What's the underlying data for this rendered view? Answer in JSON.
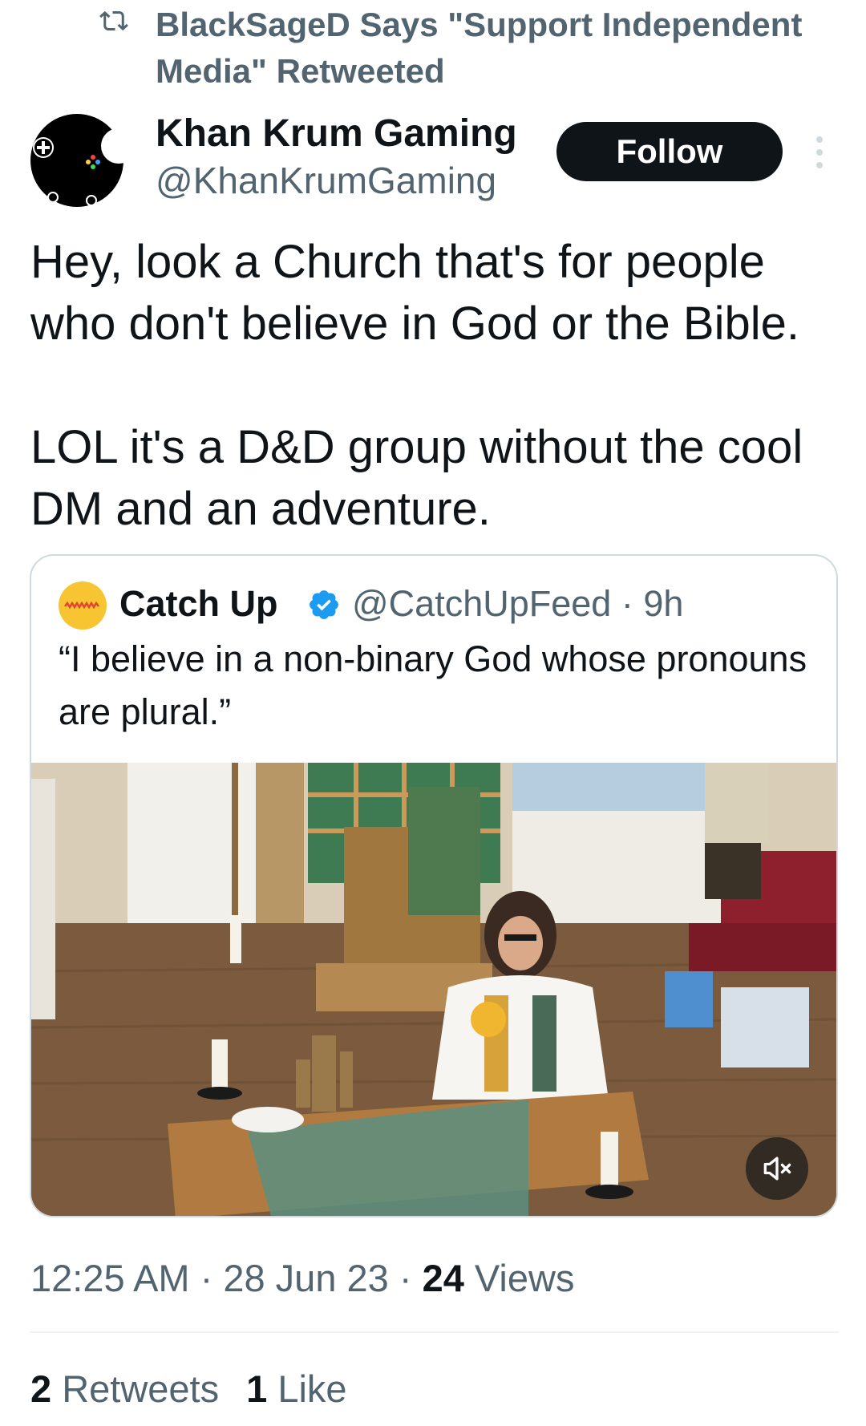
{
  "retweet_banner": {
    "text": "BlackSageD Says \"Support Independent Media\" Retweeted",
    "icon": "retweet-icon"
  },
  "author": {
    "name": "Khan Krum Gaming",
    "handle": "@KhanKrumGaming",
    "avatar_icon": "gamepad-avatar"
  },
  "follow_button": {
    "label": "Follow"
  },
  "more_menu": {
    "icon": "more-vertical-icon"
  },
  "tweet": {
    "text_line1": "Hey, look a Church that's for people who don't believe in God or the Bible.",
    "text_line2": "LOL it's a D&D group without the cool DM and an adventure."
  },
  "quote": {
    "name": "Catch Up",
    "handle_time": "@CatchUpFeed · 9h",
    "text": "“I believe in a non-binary God whose pronouns are plural.”",
    "media_icon": "video-thumbnail",
    "mute_icon": "mute-icon"
  },
  "meta": {
    "time_date": "12:25 AM · 28 Jun 23 · ",
    "views_count": "24",
    "views_label": " Views"
  },
  "stats": {
    "retweets_count": "2",
    "retweets_label": " Retweets",
    "likes_count": "1",
    "likes_label": " Like"
  },
  "colors": {
    "text_primary": "#0f1419",
    "text_secondary": "#536471",
    "border": "#cfd9de",
    "verified_blue": "#1d9bf0",
    "catchup_yellow": "#f7c531"
  }
}
